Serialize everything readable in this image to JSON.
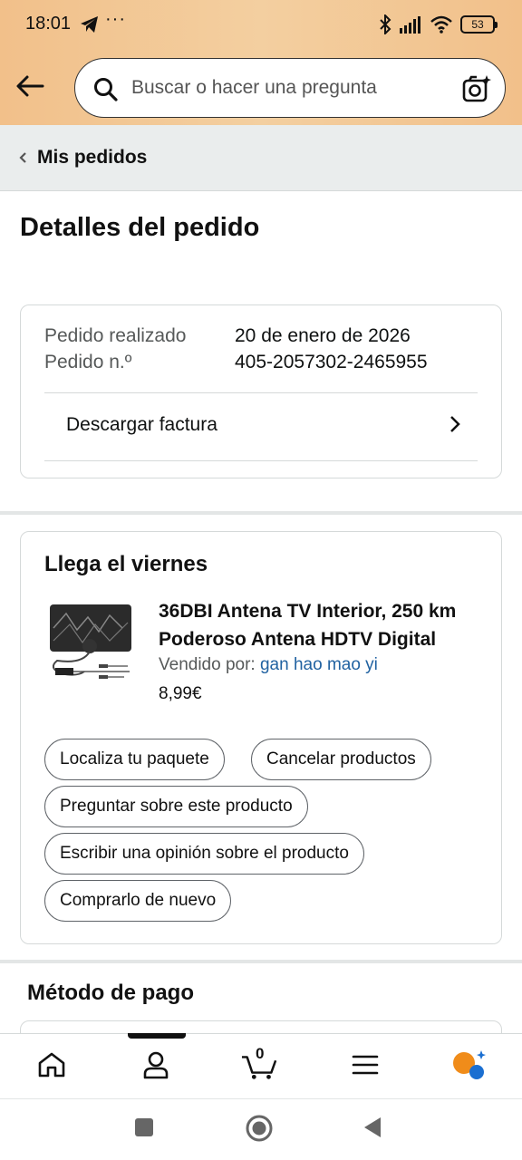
{
  "status_bar": {
    "time": "18:01",
    "battery": "53",
    "icons": [
      "telegram-icon",
      "more-dots-icon",
      "bluetooth-icon",
      "signal-icon",
      "wifi-icon",
      "battery-icon"
    ]
  },
  "header": {
    "search_placeholder": "Buscar o hacer una pregunta"
  },
  "breadcrumb": {
    "label": "Mis pedidos"
  },
  "page": {
    "title": "Detalles del pedido"
  },
  "order_info": {
    "rows": [
      {
        "label": "Pedido realizado",
        "value": "20 de enero de 2026"
      },
      {
        "label": "Pedido n.º",
        "value": "405-2057302-2465955"
      }
    ],
    "invoice_label": "Descargar factura"
  },
  "shipment": {
    "heading": "Llega el viernes",
    "product": {
      "title": "36DBI Antena TV Interior, 250 km Poderoso Antena HDTV Digital",
      "seller_prefix": "Vendido por: ",
      "seller": "gan hao mao yi",
      "price": "8,99€"
    },
    "actions": [
      "Localiza tu paquete",
      "Cancelar productos",
      "Preguntar sobre este producto",
      "Escribir una opinión sobre el producto",
      "Comprarlo de nuevo"
    ]
  },
  "payment": {
    "heading": "Método de pago"
  },
  "tabbar": {
    "cart_count": "0",
    "tabs": [
      "home-icon",
      "account-icon",
      "cart-icon",
      "menu-icon",
      "rufus-assistant-icon"
    ],
    "active_tab": "account-icon"
  },
  "colors": {
    "header": "#f2c08a",
    "link": "#2162a1",
    "border": "#d5d9d9",
    "breadcrumb_bg": "#eaeded",
    "assistant_orange": "#f08c1a",
    "assistant_blue": "#1b6fd1"
  }
}
